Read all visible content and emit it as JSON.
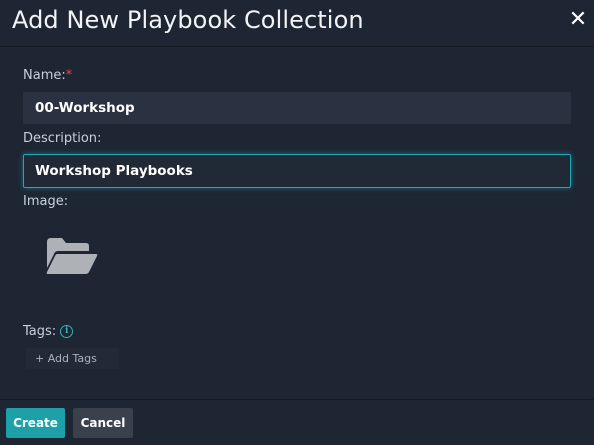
{
  "dialog": {
    "title": "Add New Playbook Collection",
    "close_symbol": "✕"
  },
  "fields": {
    "name": {
      "label": "Name:",
      "required_mark": "*",
      "value": "00-Workshop"
    },
    "description": {
      "label": "Description:",
      "value": "Workshop Playbooks"
    },
    "image": {
      "label": "Image:",
      "icon": "folder-open-icon"
    },
    "tags": {
      "label": "Tags:",
      "info_icon": "info-icon",
      "info_symbol": "i",
      "add_label": "+ Add Tags"
    }
  },
  "footer": {
    "create_label": "Create",
    "cancel_label": "Cancel"
  },
  "colors": {
    "background": "#1e2533",
    "accent": "#1ea0a8",
    "required": "#e0474c"
  }
}
